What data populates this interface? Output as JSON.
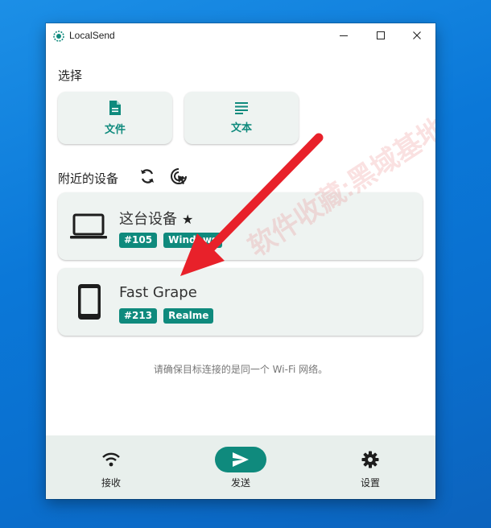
{
  "window": {
    "title": "LocalSend"
  },
  "select_section": {
    "title": "选择",
    "cards": [
      {
        "label": "文件",
        "icon": "file-icon"
      },
      {
        "label": "文本",
        "icon": "text-icon"
      }
    ]
  },
  "nearby_section": {
    "title": "附近的设备",
    "refresh_icon": "refresh-icon",
    "scan_icon": "scan-target-icon"
  },
  "devices": [
    {
      "name": "这台设备",
      "star": "★",
      "tags": [
        "#105",
        "Windows"
      ],
      "icon": "laptop-icon"
    },
    {
      "name": "Fast Grape",
      "tags": [
        "#213",
        "Realme"
      ],
      "icon": "phone-icon"
    }
  ],
  "hint": "请确保目标连接的是同一个 Wi-Fi 网络。",
  "bottom_nav": {
    "items": [
      {
        "label": "接收",
        "icon": "wifi-icon"
      },
      {
        "label": "发送",
        "icon": "send-icon"
      },
      {
        "label": "设置",
        "icon": "gear-icon"
      }
    ]
  },
  "watermark": "软件收藏:黑域基地 Hybase.com",
  "colors": {
    "accent": "#0f8a7d",
    "card_bg": "#eef3f1",
    "nav_bg": "#e8efec",
    "desktop": "#0b78d8",
    "annotation_arrow": "#e8212a"
  }
}
